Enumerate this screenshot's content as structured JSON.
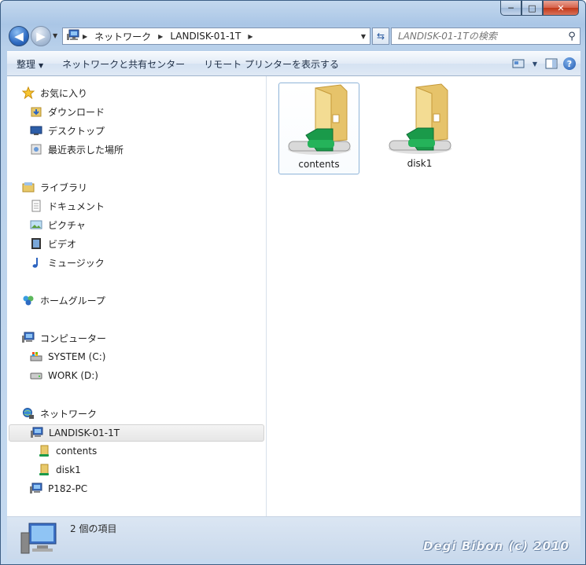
{
  "window": {
    "caption_buttons": [
      "─",
      "□",
      "✕"
    ]
  },
  "nav": {
    "back_glyph": "◀",
    "forward_glyph": "▶",
    "breadcrumb": [
      "ネットワーク",
      "LANDISK-01-1T"
    ],
    "search_placeholder": "LANDISK-01-1Tの検索"
  },
  "toolbar": {
    "organize": "整理",
    "network_center": "ネットワークと共有センター",
    "show_printers": "リモート プリンターを表示する"
  },
  "sidebar": {
    "favorites": {
      "label": "お気に入り",
      "items": [
        "ダウンロード",
        "デスクトップ",
        "最近表示した場所"
      ]
    },
    "libraries": {
      "label": "ライブラリ",
      "items": [
        "ドキュメント",
        "ピクチャ",
        "ビデオ",
        "ミュージック"
      ]
    },
    "homegroup": {
      "label": "ホームグループ"
    },
    "computer": {
      "label": "コンピューター",
      "items": [
        "SYSTEM (C:)",
        "WORK (D:)"
      ]
    },
    "network": {
      "label": "ネットワーク",
      "host": "LANDISK-01-1T",
      "shares": [
        "contents",
        "disk1"
      ],
      "other": "P182-PC"
    }
  },
  "content": {
    "items": [
      {
        "name": "contents",
        "selected": true
      },
      {
        "name": "disk1",
        "selected": false
      }
    ]
  },
  "status": {
    "count_text": "2 個の項目"
  },
  "watermark": "Degi Bibon (c) 2010",
  "colors": {
    "accent": "#2e6bc2",
    "selection_border": "#8fb4d8",
    "share_green": "#1a9a4a",
    "folder": "#e8c96a"
  }
}
